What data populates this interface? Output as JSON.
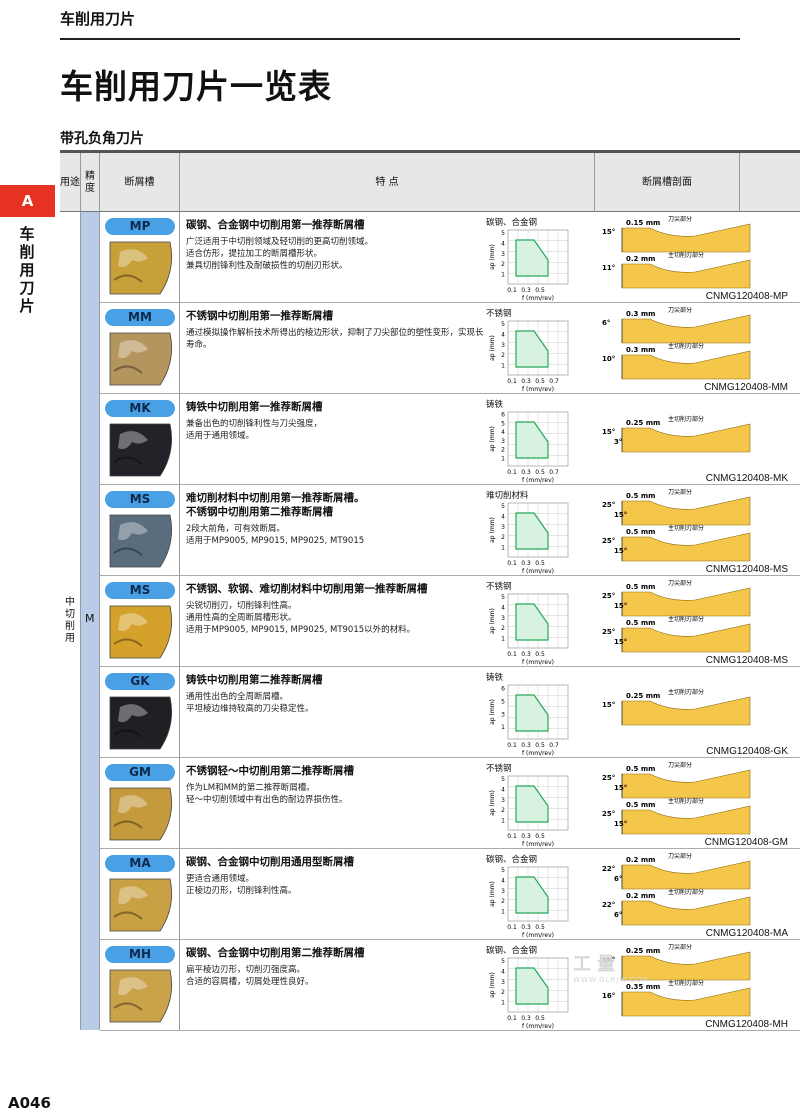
{
  "header": {
    "section": "车削用刀片",
    "title": "车削用刀片一览表",
    "table_title": "带孔负角刀片"
  },
  "side": {
    "badge": "A",
    "label": "车削用刀片"
  },
  "columns": {
    "use": "用途",
    "precision": "精度",
    "groove": "断屑槽",
    "features": "特 点",
    "profile": "断屑槽剖面"
  },
  "use_value": "中切削用",
  "precision_value": "M",
  "chart_axes": {
    "ylabel": "ap (mm)",
    "xlabel": "f (mm/rev)"
  },
  "rows": [
    {
      "code": "MP",
      "title": "碳钢、合金钢中切削用第一推荐断屑槽",
      "desc": "广泛适用于中切削领域及轻切削的更高切削领域。\n适合仿形，提拉加工的断屑槽形状。\n兼具切削锋利性及耐破损性的切削刃形状。",
      "material": "碳钢、合金钢",
      "yticks": [
        "1",
        "2",
        "3",
        "4",
        "5"
      ],
      "xticks": [
        "0.1",
        "0.3",
        "0.5"
      ],
      "profile_code": "CNMG120408-MP",
      "top_angle": "15°",
      "top_width": "0.15 mm",
      "top_label": "刀尖部分",
      "bot_angle": "11°",
      "bot_width": "0.2 mm",
      "bot_label": "主切削刃部分",
      "color": "#c8a03a"
    },
    {
      "code": "MM",
      "title": "不锈钢中切削用第一推荐断屑槽",
      "desc": "通过模拟操作解析技术所得出的棱边形状，抑制了刀尖部位的塑性变形，实现长寿命。",
      "material": "不锈钢",
      "yticks": [
        "1",
        "2",
        "3",
        "4",
        "5"
      ],
      "xticks": [
        "0.1",
        "0.3",
        "0.5",
        "0.7"
      ],
      "profile_code": "CNMG120408-MM",
      "top_angle": "6°",
      "top_width": "0.3 mm",
      "top_label": "刀尖部分",
      "bot_angle": "10°",
      "bot_width": "0.3 mm",
      "bot_label": "主切削刃部分",
      "color": "#b5955e"
    },
    {
      "code": "MK",
      "title": "铸铁中切削用第一推荐断屑槽",
      "desc": "兼备出色的切削锋利性与刀尖强度，\n适用于通用领域。",
      "material": "铸铁",
      "yticks": [
        "1",
        "2",
        "3",
        "4",
        "5",
        "6"
      ],
      "xticks": [
        "0.1",
        "0.3",
        "0.5",
        "0.7"
      ],
      "profile_code": "CNMG120408-MK",
      "top_angle": "15°",
      "top_width": "0.25 mm",
      "top_label": "主切削刃部分",
      "bot_angle": "3°",
      "bot_width": "",
      "bot_label": "",
      "color": "#222228"
    },
    {
      "code": "MS",
      "title": "难切削材料中切削用第一推荐断屑槽。\n不锈钢中切削用第二推荐断屑槽",
      "desc": "2段大前角，可有效断屑。\n适用于MP9005, MP9015, MP9025, MT9015",
      "material": "难切削材料",
      "yticks": [
        "1",
        "2",
        "3",
        "4",
        "5"
      ],
      "xticks": [
        "0.1",
        "0.3",
        "0.5"
      ],
      "profile_code": "CNMG120408-MS",
      "top_angle": "25°",
      "top_width": "0.5 mm",
      "top_label": "刀尖部分",
      "bot_angle": "25°",
      "bot_width": "0.5 mm",
      "bot_label": "主切削刃部分",
      "top_angle2": "15°",
      "bot_angle2": "15°",
      "color": "#5a6d7e"
    },
    {
      "code": "MS",
      "title": "不锈钢、软钢、难切削材料中切削用第一推荐断屑槽",
      "desc": "尖锐切削刃，切削锋利性高。\n通用性高的全周断屑槽形状。\n适用于MP9005, MP9015, MP9025, MT9015以外的材料。",
      "material": "不锈钢",
      "yticks": [
        "1",
        "2",
        "3",
        "4",
        "5"
      ],
      "xticks": [
        "0.1",
        "0.3",
        "0.5"
      ],
      "profile_code": "CNMG120408-MS",
      "top_angle": "25°",
      "top_width": "0.5 mm",
      "top_label": "刀尖部分",
      "bot_angle": "25°",
      "bot_width": "0.5 mm",
      "bot_label": "主切削刃部分",
      "top_angle2": "15°",
      "bot_angle2": "15°",
      "color": "#d4a12a"
    },
    {
      "code": "GK",
      "title": "铸铁中切削用第二推荐断屑槽",
      "desc": "通用性出色的全周断屑槽。\n平坦棱边维持较高的刀尖稳定性。",
      "material": "铸铁",
      "yticks": [
        "1",
        "3",
        "5",
        "6"
      ],
      "xticks": [
        "0.1",
        "0.3",
        "0.5",
        "0.7"
      ],
      "profile_code": "CNMG120408-GK",
      "top_angle": "15°",
      "top_width": "0.25 mm",
      "top_label": "主切削刃部分",
      "bot_angle": "",
      "bot_width": "",
      "bot_label": "",
      "color": "#1f1f24"
    },
    {
      "code": "GM",
      "title": "不锈钢轻～中切削用第二推荐断屑槽",
      "desc": "作为LM和MM的第二推荐断屑槽。\n轻～中切削领域中有出色的耐边界损伤性。",
      "material": "不锈钢",
      "yticks": [
        "1",
        "2",
        "3",
        "4",
        "5"
      ],
      "xticks": [
        "0.1",
        "0.3",
        "0.5"
      ],
      "profile_code": "CNMG120408-GM",
      "top_angle": "25°",
      "top_width": "0.5 mm",
      "top_label": "刀尖部分",
      "bot_angle": "25°",
      "bot_width": "0.5 mm",
      "bot_label": "主切削刃部分",
      "top_angle2": "15°",
      "bot_angle2": "15°",
      "color": "#c49a3c"
    },
    {
      "code": "MA",
      "title": "碳钢、合金钢中切削用通用型断屑槽",
      "desc": "更适合通用领域。\n正棱边刃形，切削锋利性高。",
      "material": "碳钢、合金钢",
      "yticks": [
        "1",
        "2",
        "3",
        "4",
        "5"
      ],
      "xticks": [
        "0.1",
        "0.3",
        "0.5"
      ],
      "profile_code": "CNMG120408-MA",
      "top_angle": "22°",
      "top_width": "0.2 mm",
      "top_label": "刀尖部分",
      "bot_angle": "22°",
      "bot_width": "0.2 mm",
      "bot_label": "主切削刃部分",
      "top_angle2": "6°",
      "bot_angle2": "6°",
      "color": "#caa044"
    },
    {
      "code": "MH",
      "title": "碳钢、合金钢中切削用第二推荐断屑槽",
      "desc": "扁平棱边刃形，切削刃强度高。\n合适的容屑槽，切屑处理性良好。",
      "material": "碳钢、合金钢",
      "yticks": [
        "1",
        "2",
        "3",
        "4",
        "5"
      ],
      "xticks": [
        "0.1",
        "0.3",
        "0.5"
      ],
      "profile_code": "CNMG120408-MH",
      "top_angle": "16°",
      "top_width": "0.25 mm",
      "top_label": "刀尖部分",
      "bot_angle": "16°",
      "bot_width": "0.35 mm",
      "bot_label": "主切削刃部分",
      "color": "#c9a24a"
    }
  ],
  "watermark": {
    "main": "工量",
    "sub": "WWW.GLRJW.COM"
  },
  "footer": {
    "page": "A046"
  }
}
